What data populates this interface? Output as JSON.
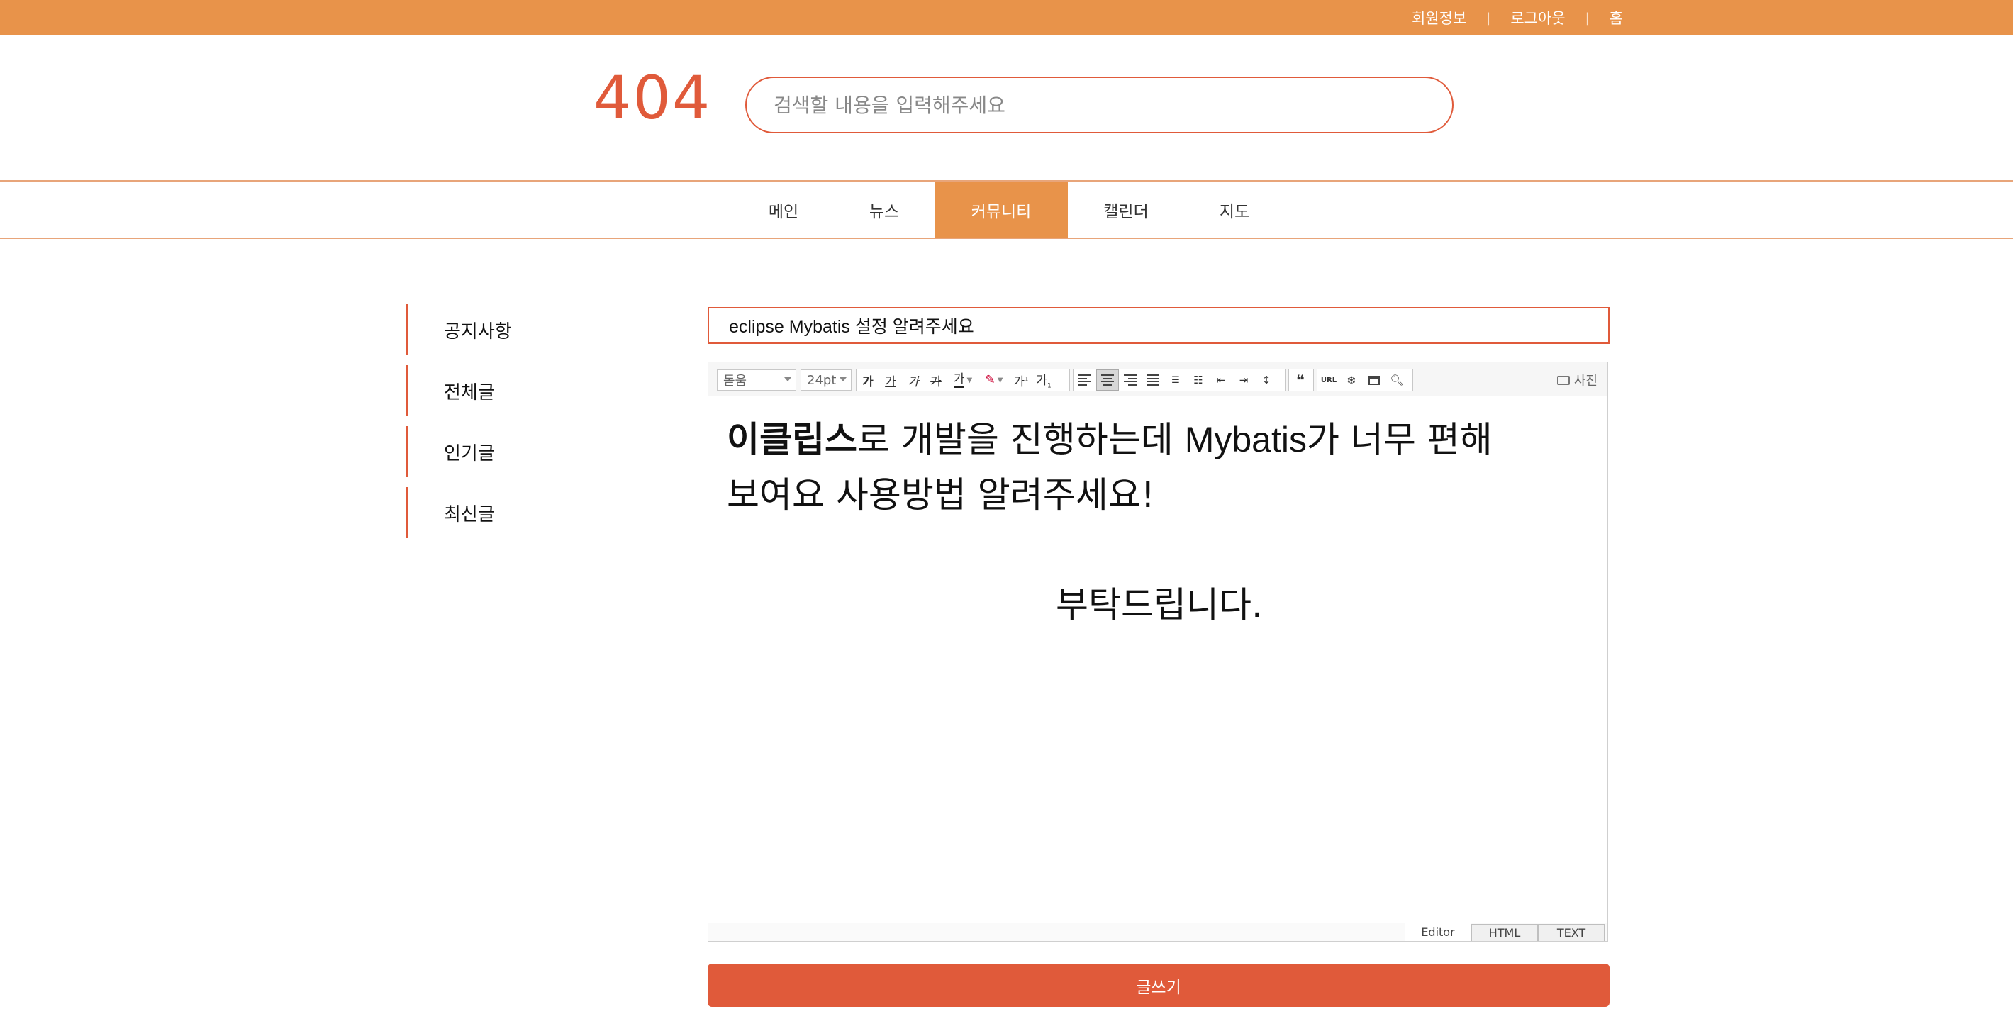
{
  "topbar": {
    "links": [
      "회원정보",
      "로그아웃",
      "홈"
    ],
    "separator": "|"
  },
  "header": {
    "logo": "404",
    "search_placeholder": "검색할 내용을 입력해주세요"
  },
  "nav": {
    "items": [
      "메인",
      "뉴스",
      "커뮤니티",
      "캘린더",
      "지도"
    ],
    "active": "커뮤니티"
  },
  "sidebar": {
    "items": [
      "공지사항",
      "전체글",
      "인기글",
      "최신글"
    ]
  },
  "post": {
    "title": "eclipse Mybatis 설정 알려주세요"
  },
  "editor": {
    "font_select": "돋움",
    "size_select": "24pt",
    "format_buttons": [
      "가",
      "가",
      "가",
      "가",
      "가"
    ],
    "photo_label": "사진",
    "url_label": "URL",
    "quote_glyph": "❝",
    "content": {
      "line1_bold": "이클립스",
      "line1_rest": "로 개발을 진행하는데 ",
      "line1_bold2": "Mybatis",
      "line1_rest2": "가 너무 편해",
      "line2": "보여요 사용방법 알려주세요!",
      "center_line": "부탁드립니다."
    },
    "mode_tabs": [
      "Editor",
      "HTML",
      "TEXT"
    ],
    "active_mode": "Editor"
  },
  "submit_label": "글쓰기",
  "colors": {
    "accent": "#e8934a",
    "brand": "#e05a3a"
  }
}
